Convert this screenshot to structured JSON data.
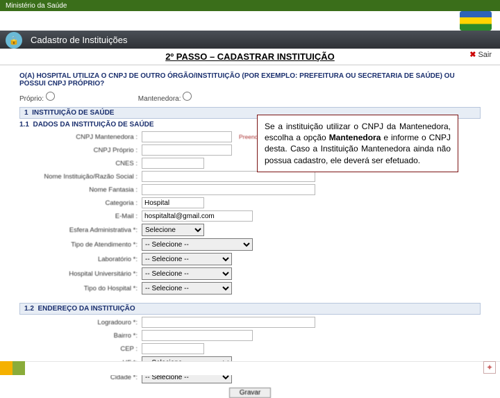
{
  "topbar": {
    "ministry": "Ministério da Saúde"
  },
  "module": {
    "title": "Cadastro de Instituições",
    "exit_label": "Sair"
  },
  "step": {
    "text": "2º PASSO – CADASTRAR INSTITUIÇÃO"
  },
  "question": "O(A) HOSPITAL UTILIZA O CNPJ DE OUTRO ÓRGÃO/INSTITUIÇÃO (POR EXEMPLO: PREFEITURA OU SECRETARIA DE SAÚDE) OU POSSUI CNPJ PRÓPRIO?",
  "radios": {
    "proprio": "Próprio:",
    "mantenedora": "Mantenedora:"
  },
  "sec1": {
    "num": "1",
    "title": "INSTITUIÇÃO DE SAÚDE",
    "sub_num": "1.1",
    "sub_title": "DADOS DA INSTITUIÇÃO DE SAÚDE"
  },
  "fields": {
    "cnpj_mant": {
      "label": "CNPJ Mantenedora :",
      "hint": "Preencha este campo caso não possua CNPJ próprio"
    },
    "cnpj_prop": {
      "label": "CNPJ Próprio :"
    },
    "cnes": {
      "label": "CNES :"
    },
    "razao": {
      "label": "Nome Instituição/Razão Social :"
    },
    "fantasia": {
      "label": "Nome Fantasia :"
    },
    "categoria": {
      "label": "Categoria :",
      "value": "Hospital"
    },
    "email": {
      "label": "E-Mail :",
      "value": "hospitaltal@gmail.com"
    },
    "esfera": {
      "label": "Esfera Administrativa *:",
      "value": "Selecione"
    },
    "tipo_atend": {
      "label": "Tipo de Atendimento *:",
      "value": "-- Selecione --"
    },
    "laboratorio": {
      "label": "Laboratório *:",
      "value": "-- Selecione --"
    },
    "hosp_univ": {
      "label": "Hospital Universitário *:",
      "value": "-- Selecione --"
    },
    "tipo_hosp": {
      "label": "Tipo do Hospital *:",
      "value": "-- Selecione --"
    }
  },
  "sec2": {
    "num": "1.2",
    "title": "ENDEREÇO DA INSTITUIÇÃO"
  },
  "addr": {
    "logradouro": {
      "label": "Logradouro *:"
    },
    "bairro": {
      "label": "Bairro *:"
    },
    "cep": {
      "label": "CEP :"
    },
    "uf": {
      "label": "UF *:",
      "value": "-- Selecione --"
    },
    "cidade": {
      "label": "Cidade *:",
      "value": "-- Selecione --"
    }
  },
  "gravar": "Gravar",
  "tooltip": {
    "text1": "Se a instituição utilizar o CNPJ da Mantenedora, escolha a opção ",
    "bold": "Mantenedora",
    "text2": " e informe o CNPJ desta. Caso a Instituição Mantenedora ainda não possua cadastro, ele deverá ser efetuado."
  }
}
